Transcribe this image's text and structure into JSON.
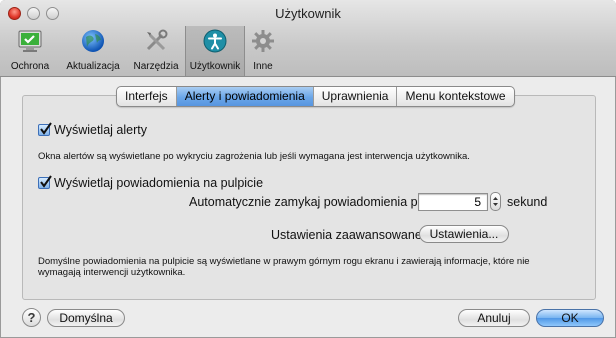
{
  "window": {
    "title": "Użytkownik"
  },
  "toolbar": {
    "items": [
      {
        "label": "Ochrona",
        "icon": "monitor-check-icon"
      },
      {
        "label": "Aktualizacja",
        "icon": "globe-icon"
      },
      {
        "label": "Narzędzia",
        "icon": "tools-icon"
      },
      {
        "label": "Użytkownik",
        "icon": "user-icon"
      },
      {
        "label": "Inne",
        "icon": "gear-icon"
      }
    ],
    "selected": "Użytkownik"
  },
  "tabs": {
    "items": [
      "Interfejs",
      "Alerty i powiadomienia",
      "Uprawnienia",
      "Menu kontekstowe"
    ],
    "active": "Alerty i powiadomienia"
  },
  "alerts": {
    "show_alerts_label": "Wyświetlaj alerty",
    "show_alerts_checked": true,
    "alerts_desc": "Okna alertów są wyświetlane po wykryciu zagrożenia lub jeśli wymagana jest interwencja użytkownika.",
    "show_notifications_label": "Wyświetlaj powiadomienia na pulpicie",
    "show_notifications_checked": true,
    "autoclose_label": "Automatycznie zamykaj powiadomienia po",
    "autoclose_value": "5",
    "autoclose_unit": "sekund",
    "advanced_label": "Ustawienia zaawansowane:",
    "advanced_button": "Ustawienia...",
    "notif_desc_line1": "Domyślne powiadomienia na pulpicie są wyświetlane w prawym górnym rogu ekranu i zawierają informacje, które nie",
    "notif_desc_line2": "wymagają interwencji użytkownika."
  },
  "footer": {
    "help": "?",
    "default_button": "Domyślna",
    "cancel_button": "Anuluj",
    "ok_button": "OK"
  },
  "colors": {
    "accent": "#5b9be3",
    "window_bg": "#ececec"
  }
}
